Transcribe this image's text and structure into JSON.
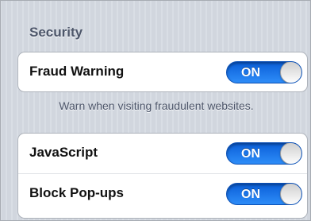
{
  "section": {
    "title": "Security",
    "footer": "Warn when visiting fraudulent websites."
  },
  "fraud_warning": {
    "label": "Fraud Warning",
    "toggle": "ON",
    "enabled": true
  },
  "javascript": {
    "label": "JavaScript",
    "toggle": "ON",
    "enabled": true
  },
  "block_popups": {
    "label": "Block Pop-ups",
    "toggle": "ON",
    "enabled": true
  },
  "colors": {
    "toggle_on": "#2e8df8",
    "section_text": "#4d566a",
    "background": "#d5dae2"
  }
}
